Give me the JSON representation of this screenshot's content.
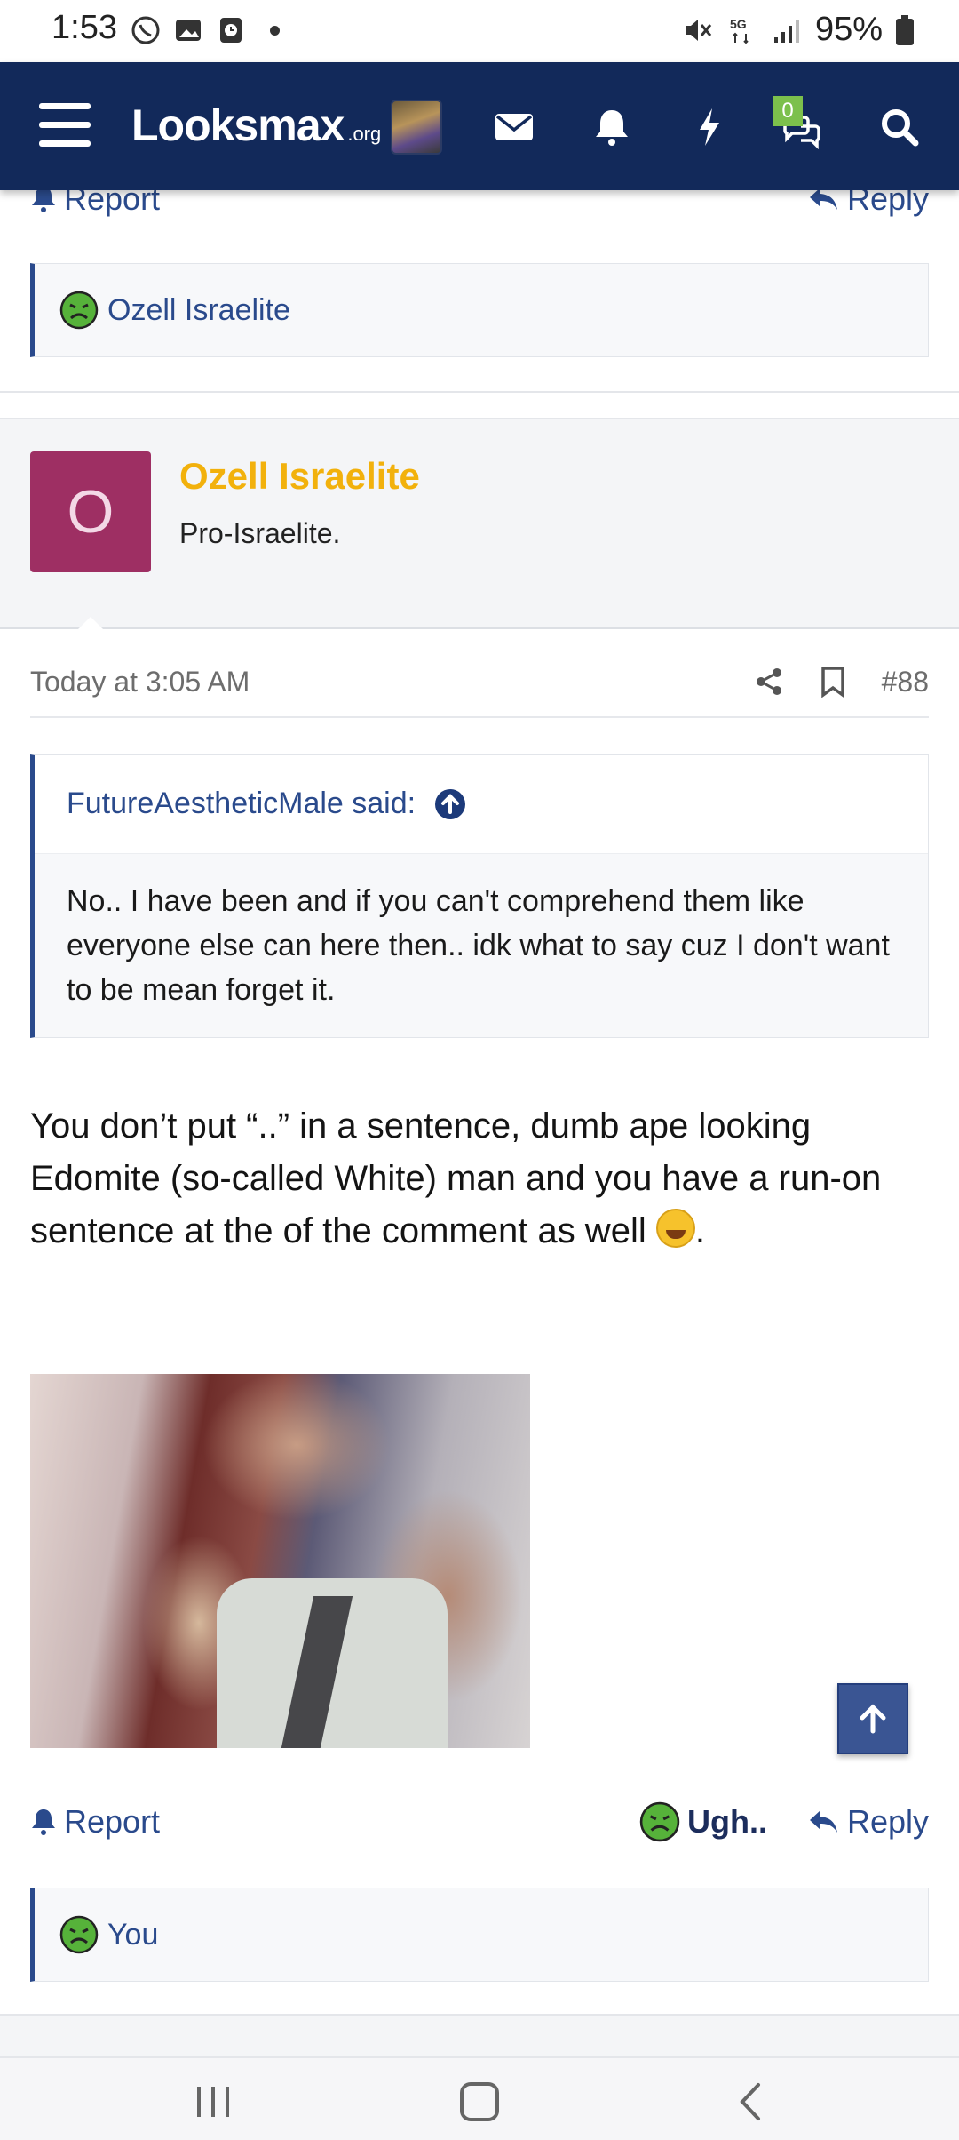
{
  "status_bar": {
    "time": "1:53",
    "battery": "95%",
    "network": "5G"
  },
  "header": {
    "logo_main": "Looksmax",
    "logo_suffix": ".org",
    "conversations_badge": "0",
    "brand_color": "#12295a"
  },
  "previous_post": {
    "report_label": "Report",
    "reply_label": "Reply",
    "reaction_user": "Ozell Israelite"
  },
  "post": {
    "author": "Ozell Israelite",
    "author_title": "Pro-Israelite.",
    "avatar_letter": "O",
    "avatar_color": "#9e2f63",
    "timestamp": "Today at 3:05 AM",
    "post_number": "#88",
    "quote_author": "FutureAestheticMale said:",
    "quote_text": "No.. I have been and if you can't comprehend them like everyone else can here then.. idk what to say cuz I don't want to be mean forget it.",
    "body_text": "You don’t put “..” in a sentence, dumb ape looking Edomite (so-called White) man and you have a run-on sentence at the of the comment as well",
    "body_end": ".",
    "report_label": "Report",
    "reaction_label": "Ugh..",
    "reply_label": "Reply",
    "reaction_user": "You"
  }
}
